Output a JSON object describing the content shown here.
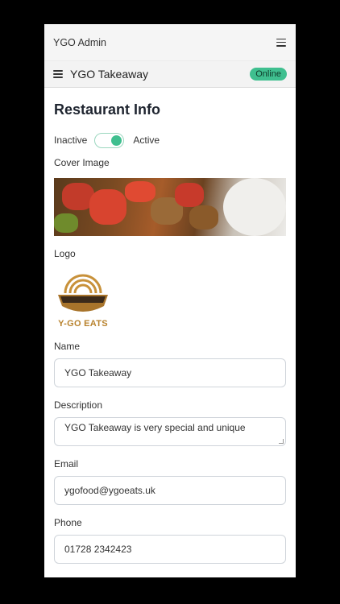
{
  "app": {
    "title": "YGO Admin"
  },
  "store": {
    "name": "YGO Takeaway",
    "status": "Online"
  },
  "page": {
    "title": "Restaurant Info"
  },
  "status": {
    "inactive_label": "Inactive",
    "active_label": "Active",
    "is_active": true
  },
  "cover": {
    "label": "Cover Image"
  },
  "logo": {
    "label": "Logo",
    "text": "Y-GO EATS"
  },
  "form": {
    "name_label": "Name",
    "name_value": "YGO Takeaway",
    "description_label": "Description",
    "description_value": "YGO Takeaway is very special and unique",
    "email_label": "Email",
    "email_value": "ygofood@ygoeats.uk",
    "phone_label": "Phone",
    "phone_value": "01728 2342423"
  },
  "colors": {
    "accent": "#3fbf8f",
    "logo_gold": "#b8822d"
  },
  "icons": {
    "menu": "hamburger-icon",
    "sidebar": "hamburger-icon"
  }
}
